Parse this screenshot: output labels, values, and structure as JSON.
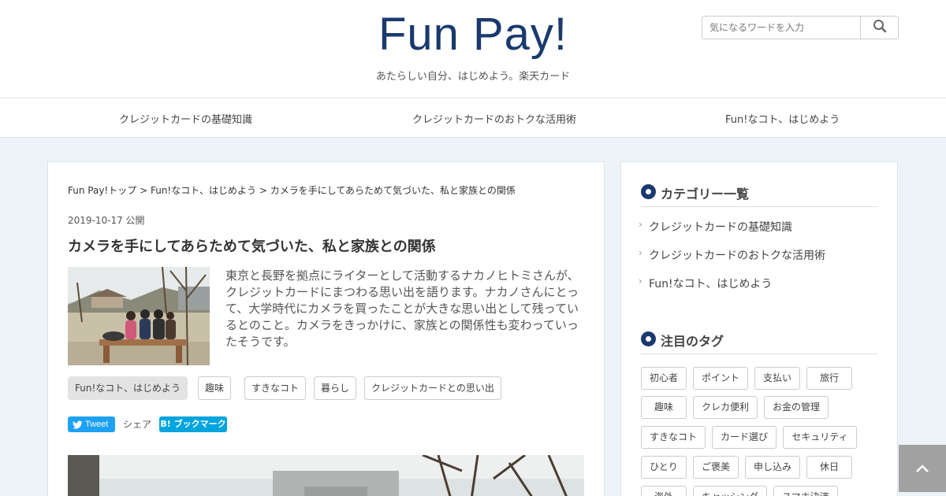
{
  "header": {
    "logo_text": "Fun Pay!",
    "tagline": "あたらしい自分、はじめよう。楽天カード",
    "search_placeholder": "気になるワードを入力",
    "search_icon": "search-icon"
  },
  "nav": {
    "items": [
      {
        "label": "クレジットカードの基礎知識"
      },
      {
        "label": "クレジットカードのおトクな活用術"
      },
      {
        "label": "Fun!なコト、はじめよう"
      }
    ]
  },
  "article": {
    "breadcrumb": [
      {
        "label": "Fun Pay!トップ"
      },
      {
        "label": "Fun!なコト、はじめよう"
      },
      {
        "label": "カメラを手にしてあらためて気づいた、私と家族との関係"
      }
    ],
    "breadcrumb_separator": ">",
    "date": "2019-10-17 公開",
    "title": "カメラを手にしてあらためて気づいた、私と家族との関係",
    "excerpt": "東京と長野を拠点にライターとして活動するナカノヒトミさんが、クレジットカードにまつわる思い出を語ります。ナカノさんにとって、大学時代にカメラを買ったことが大きな思い出として残っているとのこと。カメラをきっかけに、家族との関係性も変わっていったそうです。",
    "tags": [
      {
        "label": "Fun!なコト、はじめよう",
        "active": true
      },
      {
        "label": "趣味"
      },
      {
        "label": "すきなコト"
      },
      {
        "label": "暮らし"
      },
      {
        "label": "クレジットカードとの思い出"
      }
    ],
    "tweet_label": "Tweet",
    "share_label": "シェア",
    "hatena_label": "B! ブックマーク"
  },
  "sidebar": {
    "categories_heading": "カテゴリー一覧",
    "categories": [
      {
        "label": "クレジットカードの基礎知識"
      },
      {
        "label": "クレジットカードのおトクな活用術"
      },
      {
        "label": "Fun!なコト、はじめよう"
      }
    ],
    "tags_heading": "注目のタグ",
    "tags": [
      {
        "label": "初心者"
      },
      {
        "label": "ポイント"
      },
      {
        "label": "支払い"
      },
      {
        "label": "旅行"
      },
      {
        "label": "趣味"
      },
      {
        "label": "クレカ便利"
      },
      {
        "label": "お金の管理"
      },
      {
        "label": "すきなコト"
      },
      {
        "label": "カード選び"
      },
      {
        "label": "セキュリティ"
      },
      {
        "label": "ひとり"
      },
      {
        "label": "ご褒美"
      },
      {
        "label": "申し込み"
      },
      {
        "label": "休日"
      },
      {
        "label": "海外"
      },
      {
        "label": "キャッシング"
      },
      {
        "label": "スマホ決済"
      }
    ]
  },
  "colors": {
    "brand_navy": "#1a3a6e",
    "page_bg": "#eef3f8",
    "twitter_blue": "#1da1f2",
    "hatena_blue": "#00a4de"
  }
}
